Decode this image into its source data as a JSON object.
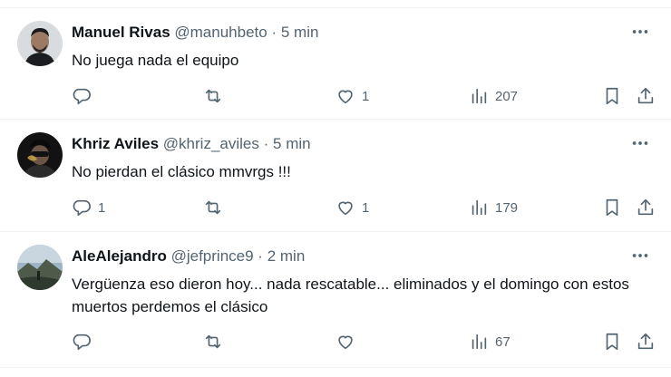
{
  "tweets": [
    {
      "name": "Manuel Rivas",
      "handle": "@manuhbeto",
      "sep": "·",
      "time": "5 min",
      "text": "No juega nada el equipo",
      "replies": "",
      "retweets": "",
      "likes": "1",
      "views": "207"
    },
    {
      "name": "Khriz Aviles",
      "handle": "@khriz_aviles",
      "sep": "·",
      "time": "5 min",
      "text": "No pierdan el clásico mmvrgs !!!",
      "replies": "1",
      "retweets": "",
      "likes": "1",
      "views": "179"
    },
    {
      "name": "AleAlejandro",
      "handle": "@jefprince9",
      "sep": "·",
      "time": "2 min",
      "text": "Vergüenza eso dieron hoy... nada rescatable... eliminados y el domingo con estos muertos perdemos el clásico",
      "replies": "",
      "retweets": "",
      "likes": "",
      "views": "67"
    }
  ],
  "icons": {
    "more": "more-dots-icon",
    "reply": "reply-bubble-icon",
    "retweet": "retweet-icon",
    "like": "heart-icon",
    "views": "views-bar-chart-icon",
    "bookmark": "bookmark-icon",
    "share": "share-upload-icon"
  },
  "colors": {
    "text": "#0f1419",
    "secondary": "#536471",
    "divider": "#eff3f4"
  }
}
